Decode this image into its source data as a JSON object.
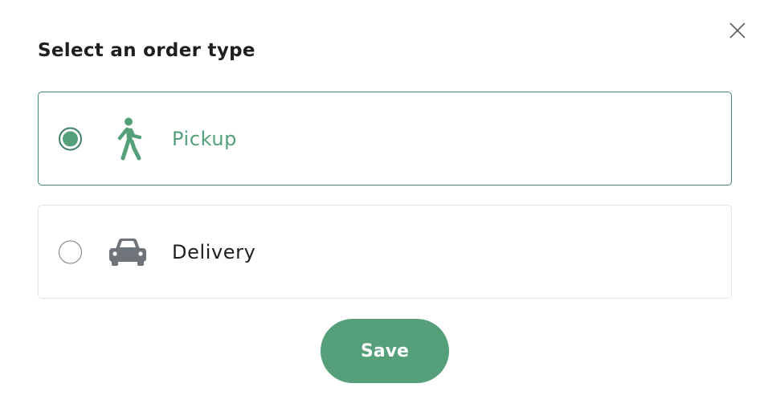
{
  "dialog": {
    "title": "Select an order type",
    "close_icon": "close-icon"
  },
  "options": [
    {
      "label": "Pickup",
      "icon": "walking-person-icon",
      "selected": true
    },
    {
      "label": "Delivery",
      "icon": "car-icon",
      "selected": false
    }
  ],
  "actions": {
    "save_label": "Save"
  },
  "colors": {
    "accent": "#55a07b",
    "accent_border": "#3d8a68",
    "car_icon": "#6f737a",
    "text": "#1f1f1f",
    "border": "#e4e4e4"
  }
}
